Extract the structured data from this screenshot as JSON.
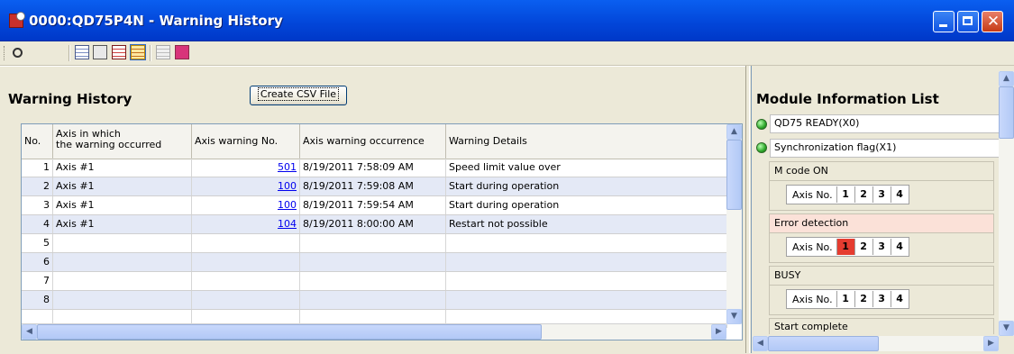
{
  "window": {
    "title": "0000:QD75P4N - Warning History"
  },
  "toolbar": {
    "buttons": [
      {
        "icon": "find-icon"
      },
      {
        "icon": "grid-view-icon"
      },
      {
        "icon": "copy-search-icon"
      },
      {
        "icon": "error-list-icon"
      },
      {
        "icon": "warning-history-icon",
        "active": true
      },
      {
        "icon": "disabled-grid-icon",
        "disabled": true
      },
      {
        "icon": "monitor-icon"
      }
    ]
  },
  "warning_history": {
    "title": "Warning History",
    "csv_button_label": "Create CSV File",
    "columns": [
      "No.",
      "Axis in which\nthe warning occurred",
      "Axis warning No.",
      "Axis warning occurrence",
      "Warning Details"
    ],
    "rows": [
      {
        "no": "1",
        "axis": "Axis #1",
        "warning_no": "501",
        "occurrence": "8/19/2011 7:58:09 AM",
        "details": "Speed limit value over"
      },
      {
        "no": "2",
        "axis": "Axis #1",
        "warning_no": "100",
        "occurrence": "8/19/2011 7:59:08 AM",
        "details": "Start during operation"
      },
      {
        "no": "3",
        "axis": "Axis #1",
        "warning_no": "100",
        "occurrence": "8/19/2011 7:59:54 AM",
        "details": "Start during operation"
      },
      {
        "no": "4",
        "axis": "Axis #1",
        "warning_no": "104",
        "occurrence": "8/19/2011 8:00:00 AM",
        "details": "Restart not possible"
      },
      {
        "no": "5",
        "axis": "",
        "warning_no": "",
        "occurrence": "",
        "details": ""
      },
      {
        "no": "6",
        "axis": "",
        "warning_no": "",
        "occurrence": "",
        "details": ""
      },
      {
        "no": "7",
        "axis": "",
        "warning_no": "",
        "occurrence": "",
        "details": ""
      },
      {
        "no": "8",
        "axis": "",
        "warning_no": "",
        "occurrence": "",
        "details": ""
      }
    ]
  },
  "module_info": {
    "title": "Module Information List",
    "status_items": [
      {
        "label": "QD75 READY(X0)",
        "led": "green"
      },
      {
        "label": "Synchronization flag(X1)",
        "led": "green"
      }
    ],
    "axis_label": "Axis No.",
    "axes": [
      "1",
      "2",
      "3",
      "4"
    ],
    "groups": [
      {
        "label": "M code ON",
        "active_axes": [],
        "highlight": false
      },
      {
        "label": "Error detection",
        "active_axes": [
          "1"
        ],
        "highlight": true
      },
      {
        "label": "BUSY",
        "active_axes": [],
        "highlight": false
      }
    ],
    "partial_item": "Start complete"
  },
  "colors": {
    "title_bar": "#0245d8",
    "alt_row": "#e4e9f6",
    "error_highlight": "#fbe1d8",
    "axis_active": "#e53c30",
    "led_green": "#2ea82a"
  }
}
